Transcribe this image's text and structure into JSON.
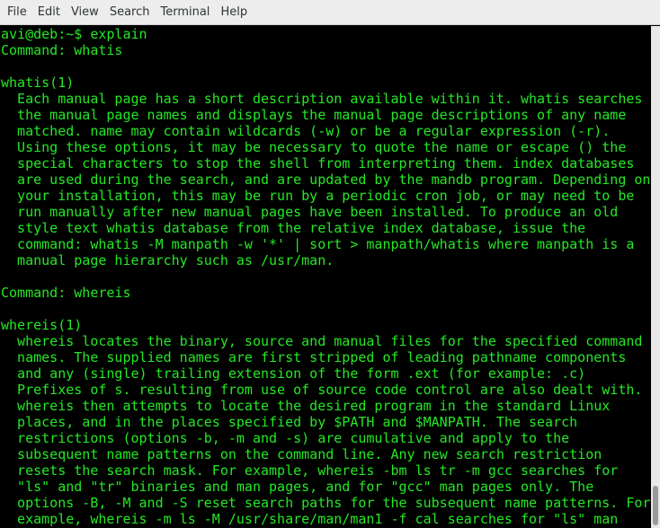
{
  "menu": [
    "File",
    "Edit",
    "View",
    "Search",
    "Terminal",
    "Help"
  ],
  "terminal": {
    "lines": [
      "avi@deb:~$ explain",
      "Command: whatis",
      "",
      "whatis(1)",
      "  Each manual page has a short description available within it. whatis searches",
      "  the manual page names and displays the manual page descriptions of any name",
      "  matched. name may contain wildcards (-w) or be a regular expression (-r).",
      "  Using these options, it may be necessary to quote the name or escape () the",
      "  special characters to stop the shell from interpreting them. index databases",
      "  are used during the search, and are updated by the mandb program. Depending on",
      "  your installation, this may be run by a periodic cron job, or may need to be",
      "  run manually after new manual pages have been installed. To produce an old",
      "  style text whatis database from the relative index database, issue the",
      "  command: whatis -M manpath -w '*' | sort > manpath/whatis where manpath is a",
      "  manual page hierarchy such as /usr/man.",
      "",
      "Command: whereis",
      "",
      "whereis(1)",
      "  whereis locates the binary, source and manual files for the specified command",
      "  names. The supplied names are first stripped of leading pathname components",
      "  and any (single) trailing extension of the form .ext (for example: .c)",
      "  Prefixes of s. resulting from use of source code control are also dealt with.",
      "  whereis then attempts to locate the desired program in the standard Linux",
      "  places, and in the places specified by $PATH and $MANPATH. The search",
      "  restrictions (options -b, -m and -s) are cumulative and apply to the",
      "  subsequent name patterns on the command line. Any new search restriction",
      "  resets the search mask. For example, whereis -bm ls tr -m gcc searches for",
      "  \"ls\" and \"tr\" binaries and man pages, and for \"gcc\" man pages only. The",
      "  options -B, -M and -S reset search paths for the subsequent name patterns. For",
      "  example, whereis -m ls -M /usr/share/man/man1 -f cal searches for \"ls\" man"
    ],
    "text_color": "#24e824",
    "background": "#000000"
  }
}
